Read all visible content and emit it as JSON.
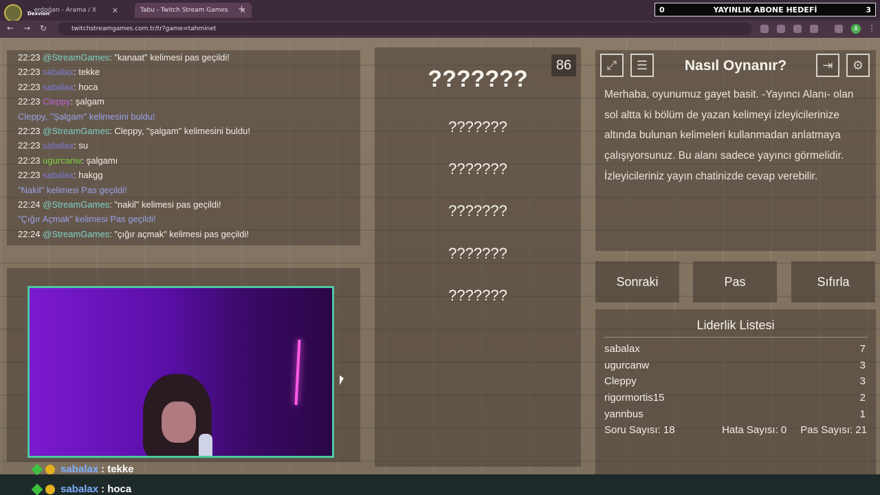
{
  "browser": {
    "profile_name": "Dexvion",
    "tabs": [
      {
        "title": "... erdoğan - Arama / X"
      },
      {
        "title": "Tabu - Twitch Stream Games"
      }
    ],
    "url": "twitchstreamgames.com.tr/tr?game=tahminet"
  },
  "goal_bar": {
    "left": "0",
    "title": "YAYINLIK ABONE HEDEFİ",
    "right": "3"
  },
  "chat_log": [
    {
      "time": "22:23",
      "user": "@StreamGames",
      "msg": ": \"kanaat\" kelimesi pas geçildi!"
    },
    {
      "time": "22:23",
      "user": "sabalax",
      "msg": ": tekke"
    },
    {
      "time": "22:23",
      "user": "sabalax",
      "msg": ": hoca"
    },
    {
      "time": "22:23",
      "user": "Cleppy",
      "msg": ": şalgam"
    },
    {
      "time": "",
      "user": "",
      "msg": "Cleppy, \"Şalgam\" kelimesini buldu!"
    },
    {
      "time": "22:23",
      "user": "@StreamGames",
      "msg": ": Cleppy, \"şalgam\" kelimesini buldu!"
    },
    {
      "time": "22:23",
      "user": "sabalax",
      "msg": ": su"
    },
    {
      "time": "22:23",
      "user": "ugurcanw",
      "msg": ": şalgamı"
    },
    {
      "time": "22:23",
      "user": "sabalax",
      "msg": ": hakgg"
    },
    {
      "time": "",
      "user": "",
      "msg": "\"Nakil\" kelimesi Pas geçildi!"
    },
    {
      "time": "22:24",
      "user": "@StreamGames",
      "msg": ": \"nakil\" kelimesi pas geçildi!"
    },
    {
      "time": "",
      "user": "",
      "msg": "\"Çığır Açmak\" kelimesi Pas geçildi!"
    },
    {
      "time": "22:24",
      "user": "@StreamGames",
      "msg": ": \"çığır açmak\" kelimesi pas geçildi!"
    }
  ],
  "game": {
    "timer": "86",
    "main_word": "???????",
    "taboo_words": [
      "???????",
      "???????",
      "???????",
      "???????",
      "???????"
    ]
  },
  "howto": {
    "title": "Nasıl Oynanır?",
    "text": "Merhaba, oyunumuz gayet basit. -Yayıncı Alanı- olan sol altta ki bölüm de yazan kelimeyi izleyicilerinize altında bulunan kelimeleri kullanmadan anlatmaya çalışıyorsunuz. Bu alanı sadece yayıncı görmelidir. İzleyicileriniz yayın chatinizde cevap verebilir."
  },
  "buttons": {
    "next": "Sonraki",
    "pass": "Pas",
    "reset": "Sıfırla"
  },
  "leaderboard": {
    "title": "Liderlik Listesi",
    "rows": [
      {
        "name": "sabalax",
        "score": "7"
      },
      {
        "name": "ugurcanw",
        "score": "3"
      },
      {
        "name": "Cleppy",
        "score": "3"
      },
      {
        "name": "rigormortis15",
        "score": "2"
      },
      {
        "name": "yannbus",
        "score": "1"
      }
    ],
    "questions": "Soru Sayısı: 18",
    "errors": "Hata Sayısı: 0",
    "passes": "Pas Sayısı: 21"
  },
  "overlay_chat": [
    {
      "user": "sabalax",
      "msg": ": tekke"
    },
    {
      "user": "sabalax",
      "msg": ": hoca"
    }
  ]
}
